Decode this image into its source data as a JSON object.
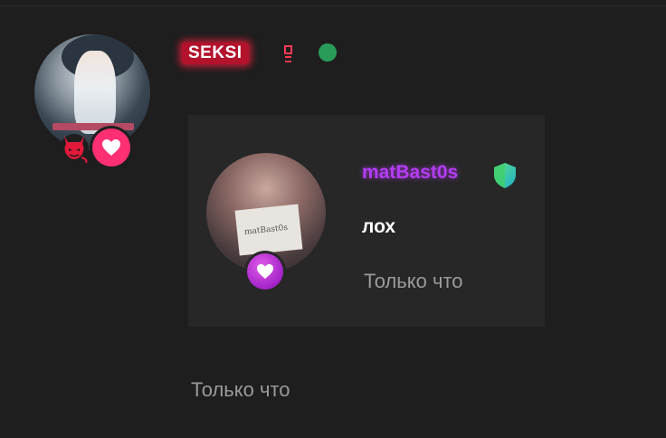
{
  "post": {
    "author_name": "SEKSI",
    "time": "Только что",
    "badge_glyph": "ʕ"
  },
  "quote": {
    "author_name": "matBast0s",
    "avatar_sign_text": "matBast0s",
    "text": "лох",
    "time": "Только что"
  },
  "icons": {
    "author_avatar": "avatar-anime-girl",
    "devil": "devil-icon",
    "heart": "heart-icon",
    "online": "online-status-dot",
    "shield": "shield-icon"
  },
  "colors": {
    "background": "#1e1e1e",
    "card_background": "#272727",
    "name_highlight": "#b3122c",
    "heart_badge": "#ff2f74",
    "quote_heart_badge": "#a323c8",
    "quote_author": "#b53cf5",
    "online": "#2a9c5a",
    "muted_text": "#9a9a9a"
  }
}
